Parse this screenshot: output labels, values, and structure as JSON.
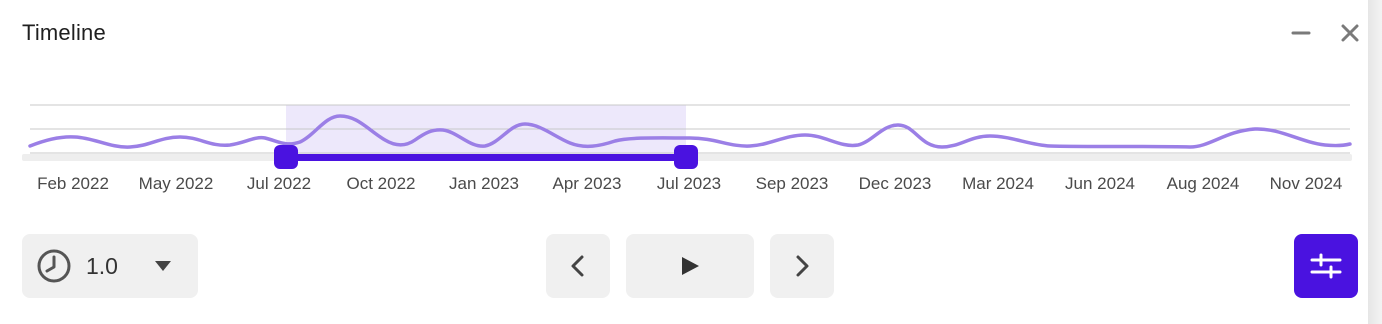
{
  "window": {
    "title": "Timeline",
    "minimize_icon": "minimize-icon",
    "close_icon": "close-icon"
  },
  "timeline": {
    "axis_labels": [
      "Feb 2022",
      "May 2022",
      "Jul 2022",
      "Oct 2022",
      "Jan 2023",
      "Apr 2023",
      "Jul 2023",
      "Sep 2023",
      "Dec 2023",
      "Mar 2024",
      "Jun 2024",
      "Aug 2024",
      "Nov 2024"
    ],
    "selection": {
      "start_label": "Jul 2022",
      "end_label": "Jul 2023"
    },
    "colors": {
      "accent": "#4a12e0",
      "wave": "#9b7fe6",
      "selection_fill": "#ede8fb",
      "track": "#eeeeee",
      "grid": "#c8c8c8"
    }
  },
  "controls": {
    "speed_icon": "clock-icon",
    "speed_value": "1.0",
    "speed_dropdown_icon": "caret-down-icon",
    "prev_icon": "chevron-left-icon",
    "play_icon": "play-icon",
    "next_icon": "chevron-right-icon",
    "settings_icon": "sliders-icon"
  }
}
